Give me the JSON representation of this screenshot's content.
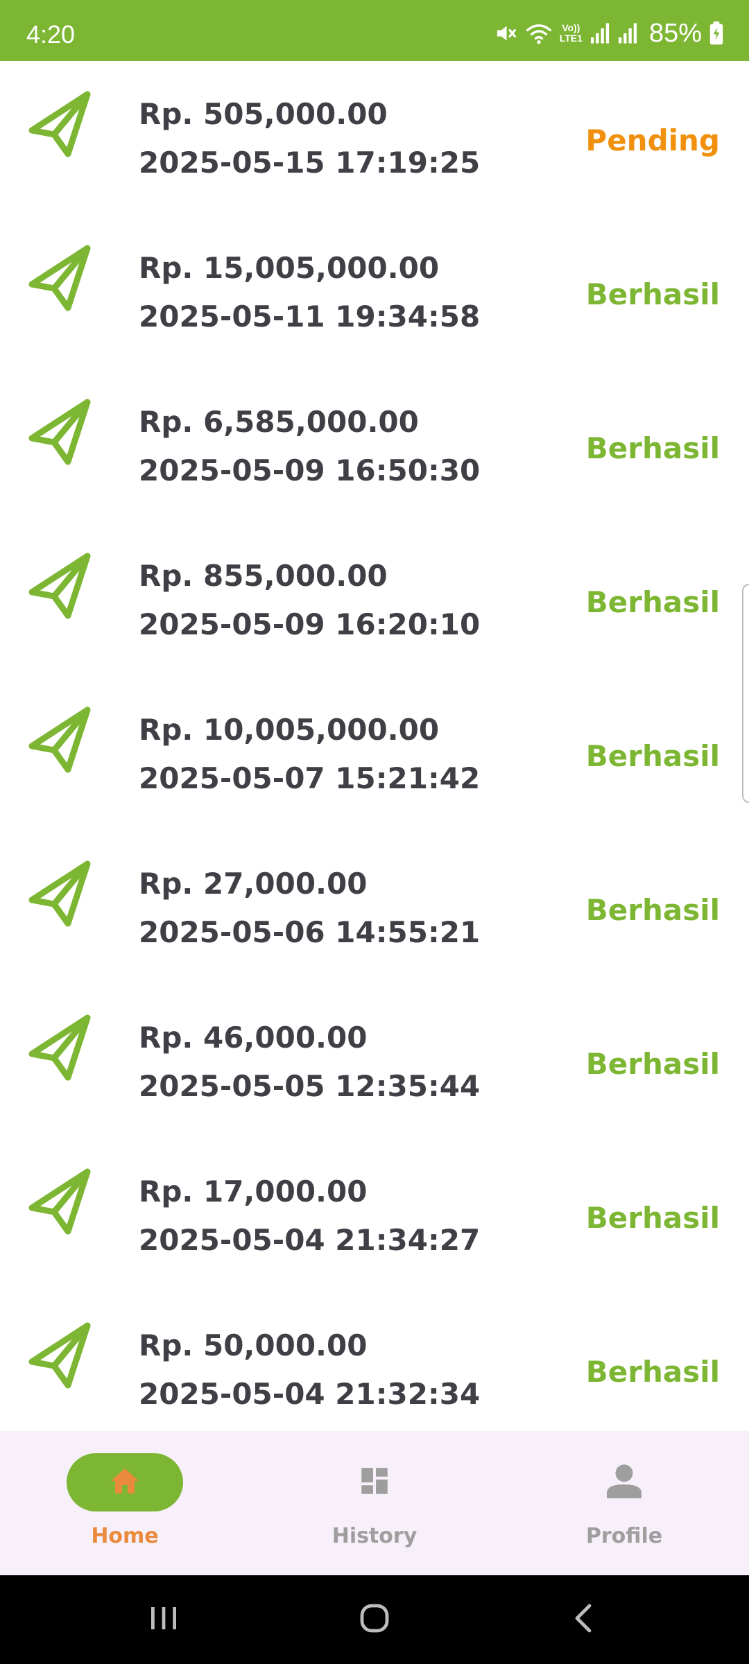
{
  "status_bar": {
    "time": "4:20",
    "battery": "85%",
    "icons": [
      "mute-icon",
      "wifi-icon",
      "volte-icon",
      "signal-icon",
      "signal-icon",
      "battery-charging-icon"
    ],
    "volte_text_top": "Vo))",
    "volte_text_bottom": "LTE1",
    "background": "#7cb632"
  },
  "transactions": [
    {
      "amount": "Rp. 505,000.00",
      "datetime": "2025-05-15 17:19:25",
      "status": "Pending",
      "status_type": "pending"
    },
    {
      "amount": "Rp. 15,005,000.00",
      "datetime": "2025-05-11 19:34:58",
      "status": "Berhasil",
      "status_type": "success"
    },
    {
      "amount": "Rp. 6,585,000.00",
      "datetime": "2025-05-09 16:50:30",
      "status": "Berhasil",
      "status_type": "success"
    },
    {
      "amount": "Rp. 855,000.00",
      "datetime": "2025-05-09 16:20:10",
      "status": "Berhasil",
      "status_type": "success"
    },
    {
      "amount": "Rp. 10,005,000.00",
      "datetime": "2025-05-07 15:21:42",
      "status": "Berhasil",
      "status_type": "success"
    },
    {
      "amount": "Rp. 27,000.00",
      "datetime": "2025-05-06 14:55:21",
      "status": "Berhasil",
      "status_type": "success"
    },
    {
      "amount": "Rp. 46,000.00",
      "datetime": "2025-05-05 12:35:44",
      "status": "Berhasil",
      "status_type": "success"
    },
    {
      "amount": "Rp. 17,000.00",
      "datetime": "2025-05-04 21:34:27",
      "status": "Berhasil",
      "status_type": "success"
    },
    {
      "amount": "Rp. 50,000.00",
      "datetime": "2025-05-04 21:32:34",
      "status": "Berhasil",
      "status_type": "success"
    }
  ],
  "transaction_icon": "paper-plane-icon",
  "bottom_nav": {
    "items": [
      {
        "label": "Home",
        "icon": "home-icon",
        "active": true
      },
      {
        "label": "History",
        "icon": "dashboard-icon",
        "active": false
      },
      {
        "label": "Profile",
        "icon": "person-icon",
        "active": false
      }
    ]
  },
  "system_nav": {
    "buttons": [
      "recents-icon",
      "home-circle-icon",
      "back-icon"
    ]
  },
  "colors": {
    "accent": "#7cb632",
    "pending": "#f0900c",
    "active_nav_label": "#ea8a3c",
    "text_dark": "#3f3f46",
    "nav_background": "#f7eff9"
  }
}
